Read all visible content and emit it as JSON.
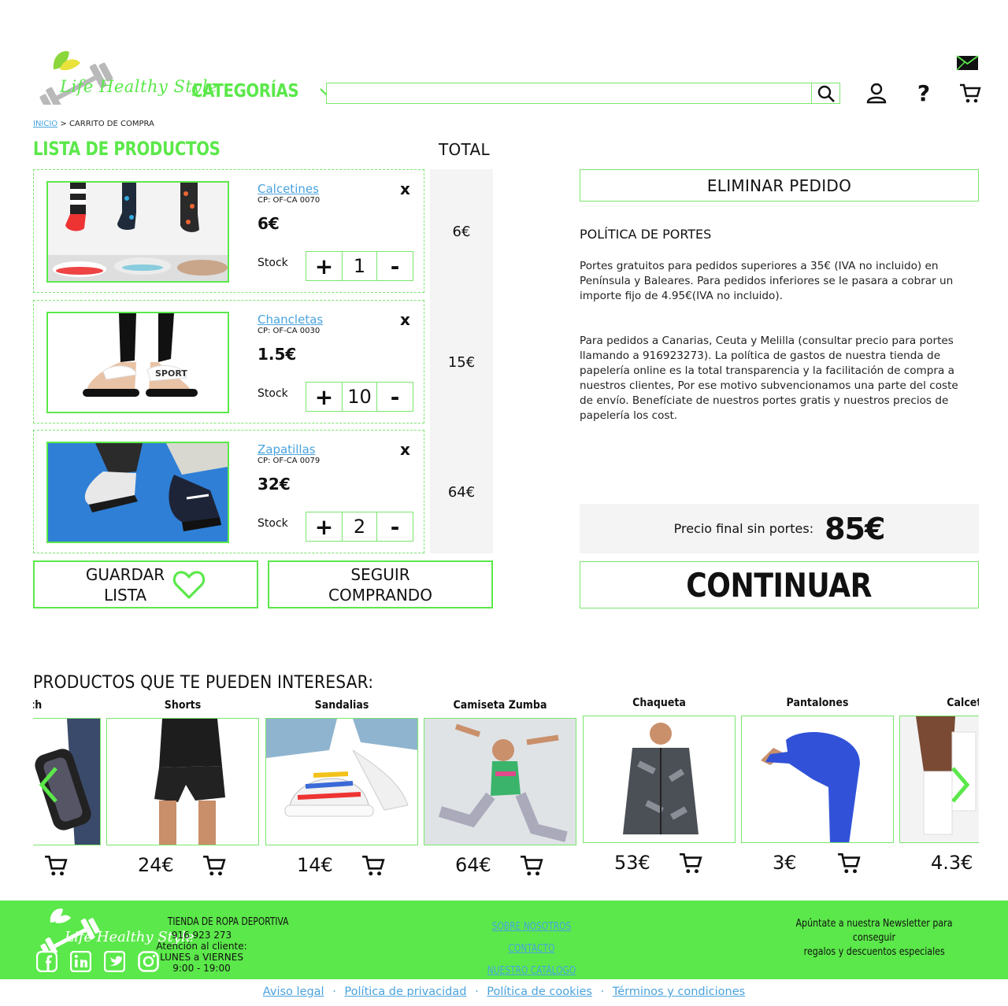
{
  "brand": {
    "name": "Life Healthy Style"
  },
  "header": {
    "categories_label": "CATEGORÍAS",
    "search_placeholder": ""
  },
  "breadcrumb": {
    "home": "INICIO",
    "separator": ">",
    "current": "CARRITO DE COMPRA"
  },
  "cart": {
    "list_title": "LISTA DE PRODUCTOS",
    "total_title": "TOTAL",
    "stock_label": "Stock",
    "remove_label": "x",
    "plus_label": "+",
    "minus_label": "-",
    "items": [
      {
        "name": "Calcetines",
        "code": "CP: OF-CA 0070",
        "price": "6€",
        "qty": "1",
        "total": "6€"
      },
      {
        "name": "Chancletas",
        "code": "CP: OF-CA 0030",
        "price": "1.5€",
        "qty": "10",
        "total": "15€"
      },
      {
        "name": "Zapatillas",
        "code": "CP: OF-CA 0079",
        "price": "32€",
        "qty": "2",
        "total": "64€"
      }
    ],
    "save_list_line1": "GUARDAR",
    "save_list_line2": "LISTA",
    "keep_shopping_line1": "SEGUIR",
    "keep_shopping_line2": "COMPRANDO"
  },
  "summary": {
    "delete_order": "ELIMINAR PEDIDO",
    "policy_title": "POLÍTICA DE PORTES",
    "policy_p1": "Portes gratuitos para pedidos superiores a 35€ (IVA no incluido) en Península y Baleares. Para pedidos inferiores se le pasara a cobrar un importe fijo de 4.95€(IVA no incluido).",
    "policy_p2": "Para pedidos a Canarias, Ceuta y Melilla (consultar precio para portes llamando a 916923273). La política de gastos de nuestra tienda de papelería online es la total transparencia y la facilitación de compra a nuestros clientes, Por ese motivo subvencionamos una parte del coste de envío. Benefíciate de nuestros portes gratis y nuestros precios de papelería los cost.",
    "final_label": "Precio final sin portes:",
    "final_value": "85€",
    "continue": "CONTINUAR"
  },
  "recommendations": {
    "title": "PRODUCTOS QUE TE PUEDEN INTERESAR:",
    "items": [
      {
        "name": "Watch",
        "price": ""
      },
      {
        "name": "Shorts",
        "price": "24€"
      },
      {
        "name": "Sandalias",
        "price": "14€"
      },
      {
        "name": "Camiseta Zumba",
        "price": "64€"
      },
      {
        "name": "Chaqueta",
        "price": "53€"
      },
      {
        "name": "Pantalones",
        "price": "3€"
      },
      {
        "name": "Calcetines",
        "price": "4.3€"
      }
    ]
  },
  "footer": {
    "shop_type": "TIENDA DE ROPA DEPORTIVA",
    "phone": "916 923 273",
    "attention": "Atención al cliente:",
    "days": "LUNES a VIERNES",
    "hours": "9:00 - 19:00",
    "links": [
      "SOBRE NOSOTROS",
      "CONTACTO",
      "NUESTRO CATÁLOGO"
    ],
    "newsletter_line1": "Apúntate a nuestra Newsletter para conseguir",
    "newsletter_line2": "regalos y descuentos especiales",
    "legal": [
      "Aviso legal",
      "Política de privacidad",
      "Política de cookies",
      "Términos y condiciones"
    ],
    "legal_separator": "·"
  },
  "colors": {
    "accent": "#5be84a",
    "link": "#4aa3df",
    "panel": "#f4f4f4",
    "text": "#111111"
  },
  "icons": [
    "search-icon",
    "user-icon",
    "help-icon",
    "cart-icon",
    "chevron-down-icon",
    "heart-icon",
    "chevron-left-icon",
    "chevron-right-icon",
    "facebook-icon",
    "linkedin-icon",
    "twitter-icon",
    "instagram-icon",
    "send-mail-icon"
  ]
}
